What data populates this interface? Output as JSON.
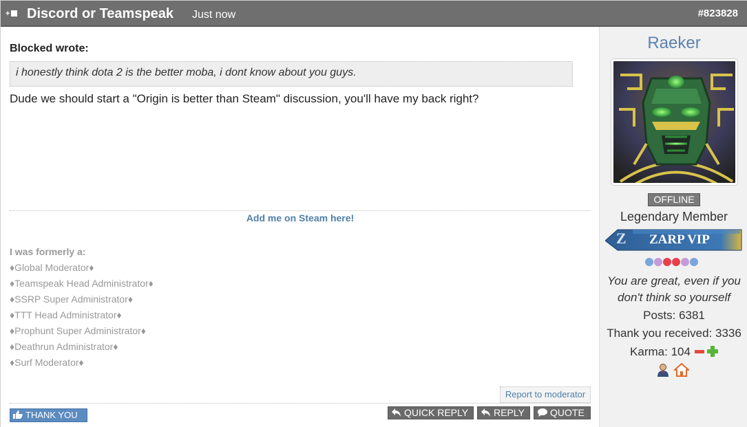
{
  "header": {
    "title": "Discord or Teamspeak",
    "time": "Just now",
    "post_number": "#823828"
  },
  "post": {
    "quote_author": "Blocked wrote:",
    "quote_text": "i honestly think dota 2 is the better moba, i dont know about you guys.",
    "body": "Dude we should start a \"Origin is better than Steam\" discussion, you'll have my back right?"
  },
  "signature": {
    "steam_link": "Add me on Steam here!",
    "former_heading": "I was formerly a:",
    "former_roles": [
      "♦Global Moderator♦",
      "♦Teamspeak Head Administrator♦",
      "♦SSRP Super Administrator♦",
      "♦TTT Head Administrator♦",
      "♦Prophunt Super Administrator♦",
      "♦Deathrun Administrator♦",
      "♦Surf Moderator♦"
    ]
  },
  "actions": {
    "report": "Report to moderator",
    "thank_you": "THANK YOU",
    "quick_reply": "QUICK REPLY",
    "reply": "REPLY",
    "quote": "QUOTE"
  },
  "user": {
    "name": "Raeker",
    "status": "OFFLINE",
    "rank": "Legendary Member",
    "vip_label": "ZARP VIP",
    "vip_letter": "Z",
    "motto_line1": "You are great, even if you",
    "motto_line2": "don't think so yourself",
    "posts": "Posts: 6381",
    "thanks_received": "Thank you received: 3336",
    "karma": "Karma: 104"
  },
  "colors": {
    "header_bg": "#6f6f6f",
    "link_blue": "#4f7fa8",
    "username_blue": "#5b82ad",
    "dots": [
      "#7aa6dd",
      "#c49ad8",
      "#e8404a",
      "#e8404a",
      "#c49ad8",
      "#7aa6dd"
    ]
  }
}
